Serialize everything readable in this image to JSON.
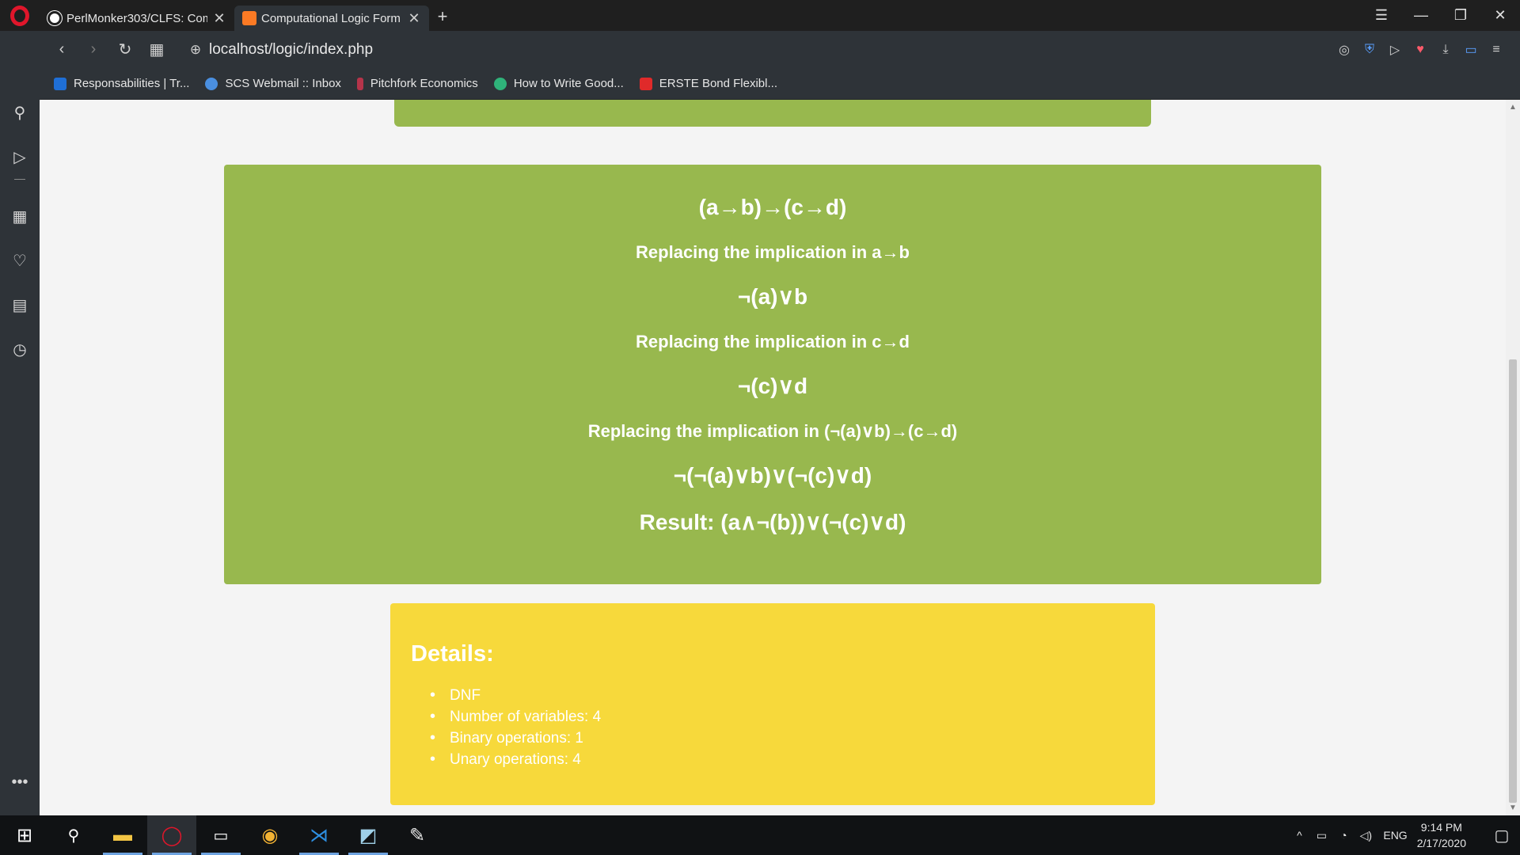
{
  "browser": {
    "tabs": [
      {
        "title": "PerlMonker303/CLFS: Comp",
        "favicon": "github-icon",
        "active": false
      },
      {
        "title": "Computational Logic Form",
        "favicon": "xampp-icon",
        "active": true
      }
    ],
    "new_tab": "+",
    "url": "localhost/logic/index.php",
    "bookmarks": [
      {
        "label": "Responsabilities | Tr...",
        "icon": "trello-icon",
        "color": "#1f6fd6"
      },
      {
        "label": "SCS Webmail :: Inbox",
        "icon": "webmail-icon",
        "color": "#4a8fe0"
      },
      {
        "label": "Pitchfork Economics",
        "icon": "pitchfork-icon",
        "color": "#b5344a"
      },
      {
        "label": "How to Write Good...",
        "icon": "quill-icon",
        "color": "#2fb37a"
      },
      {
        "label": "ERSTE Bond Flexibl...",
        "icon": "erste-icon",
        "color": "#e02a2a"
      }
    ]
  },
  "page": {
    "formula": "(a→b)→(c→d)",
    "steps": [
      {
        "label": "Replacing the implication in a→b",
        "expr": "¬(a)∨b"
      },
      {
        "label": "Replacing the implication in c→d",
        "expr": "¬(c)∨d"
      },
      {
        "label": "Replacing the implication in (¬(a)∨b)→(c→d)",
        "expr": "¬(¬(a)∨b)∨(¬(c)∨d)"
      }
    ],
    "result": "Result: (a∧¬(b))∨(¬(c)∨d)",
    "details": {
      "title": "Details:",
      "items": [
        "DNF",
        "Number of variables: 4",
        "Binary operations: 1",
        "Unary operations: 4"
      ]
    }
  },
  "taskbar": {
    "language": "ENG",
    "time": "9:14 PM",
    "date": "2/17/2020"
  },
  "colors": {
    "green_panel": "#98b84e",
    "yellow_panel": "#f7d93b",
    "opera_red": "#e0162b"
  }
}
